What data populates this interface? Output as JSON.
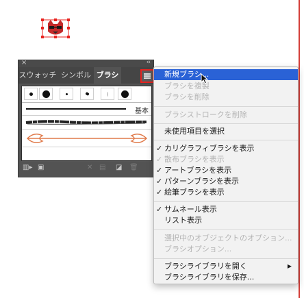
{
  "panel": {
    "close_glyph": "×",
    "collapse_glyph": "‹‹",
    "tabs": [
      {
        "label": "スウォッチ",
        "active": false
      },
      {
        "label": "シンボル",
        "active": false
      },
      {
        "label": "ブラシ",
        "active": true
      }
    ],
    "basic_brush_label": "基本"
  },
  "menu": {
    "items": [
      {
        "label": "新規ブラシ...",
        "enabled": true,
        "checked": false,
        "highlighted": true
      },
      {
        "label": "ブラシを複製",
        "enabled": false,
        "checked": false
      },
      {
        "label": "ブラシを削除",
        "enabled": false,
        "checked": false
      },
      {
        "label": "ブラシストロークを削除",
        "enabled": false,
        "checked": false
      },
      {
        "label": "未使用項目を選択",
        "enabled": true,
        "checked": false
      },
      {
        "label": "カリグラフィブラシを表示",
        "enabled": true,
        "checked": true
      },
      {
        "label": "散布ブラシを表示",
        "enabled": false,
        "checked": true
      },
      {
        "label": "アートブラシを表示",
        "enabled": true,
        "checked": true
      },
      {
        "label": "パターンブラシを表示",
        "enabled": true,
        "checked": true
      },
      {
        "label": "絵筆ブラシを表示",
        "enabled": true,
        "checked": true
      },
      {
        "label": "サムネール表示",
        "enabled": true,
        "checked": true
      },
      {
        "label": "リスト表示",
        "enabled": true,
        "checked": false
      },
      {
        "label": "選択中のオブジェクトのオプション...",
        "enabled": false,
        "checked": false
      },
      {
        "label": "ブラシオプション...",
        "enabled": false,
        "checked": false
      },
      {
        "label": "ブラシライブラリを開く",
        "enabled": true,
        "checked": false,
        "submenu": true
      },
      {
        "label": "ブラシライブラリを保存...",
        "enabled": true,
        "checked": false
      }
    ],
    "check_glyph": "✓",
    "submenu_glyph": "▶"
  },
  "colors": {
    "highlight": "#2a62d6",
    "panel_bg": "#535353",
    "accent_red": "#e8231f",
    "art_brush_stroke": "#e07a4a"
  }
}
